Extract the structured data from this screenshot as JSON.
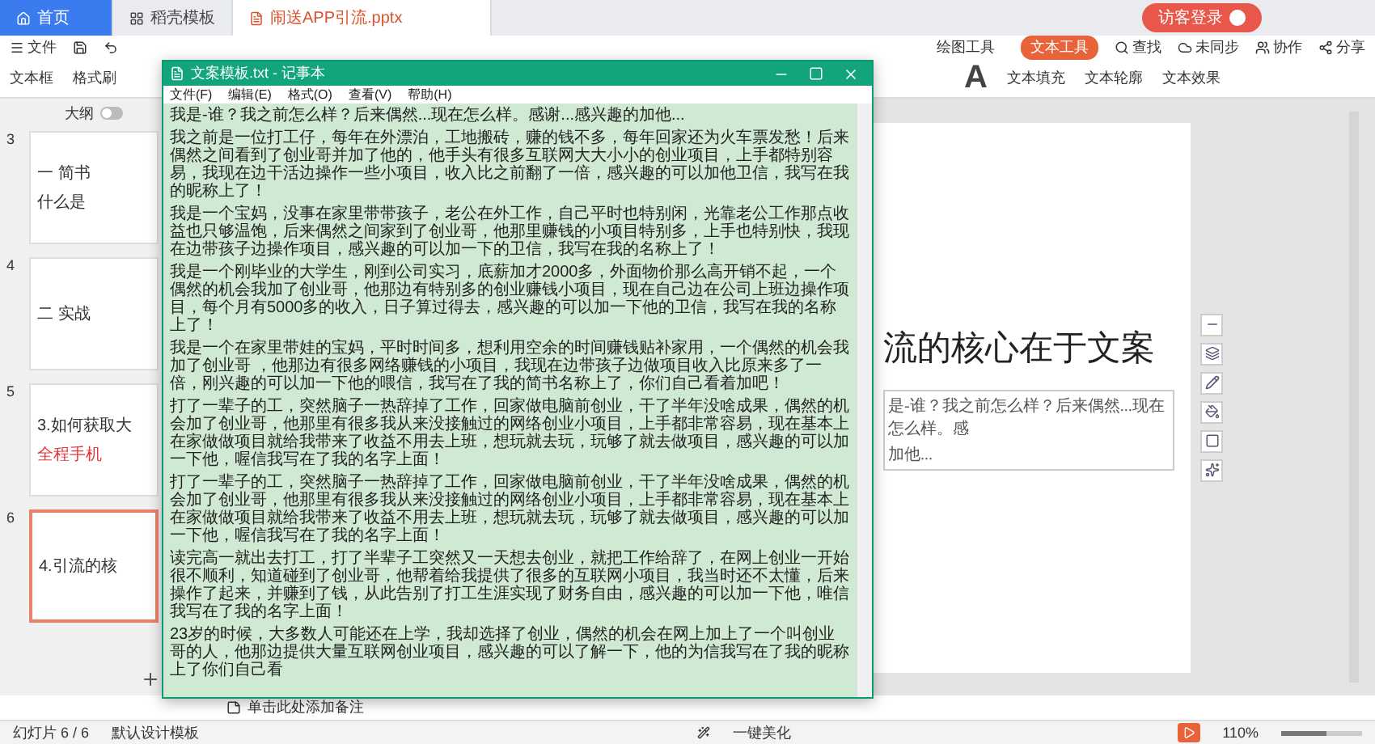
{
  "app_tabs": [
    {
      "label": "首页",
      "kind": "home",
      "selected": false
    },
    {
      "label": "稻壳模板",
      "kind": "store",
      "selected": false
    },
    {
      "label": "闹送APP引流.pptx",
      "kind": "file",
      "selected": true
    }
  ],
  "login_button": "访客登录",
  "menu": {
    "file": "文件",
    "tools": [
      {
        "label": "绘图工具",
        "selected": false
      },
      {
        "label": "文本工具",
        "selected": true
      }
    ],
    "search": "查找",
    "actions": [
      "未同步",
      "协作",
      "分享"
    ]
  },
  "ribbon": {
    "left": [
      "文本框",
      "格式刷"
    ],
    "big_letter": "A",
    "right": [
      "文本填充",
      "文本轮廓",
      "文本效果"
    ]
  },
  "panel": {
    "outline_label": "大纲",
    "view_toggle": {
      "on": false
    },
    "slides": [
      {
        "number": "3",
        "selected": false,
        "lines": [
          {
            "text": "一 简书",
            "kind": "title"
          },
          {
            "text": "什么是",
            "kind": "title"
          }
        ]
      },
      {
        "number": "4",
        "selected": false,
        "lines": [
          {
            "text": "二 实战",
            "kind": "title"
          }
        ]
      },
      {
        "number": "5",
        "selected": false,
        "lines": [
          {
            "text": "3.如何获取大",
            "kind": "title"
          },
          {
            "text": "全程手机",
            "kind": "accent"
          }
        ]
      },
      {
        "number": "6",
        "selected": true,
        "lines": [
          {
            "text": "4.引流的核",
            "kind": "title"
          }
        ]
      }
    ]
  },
  "slide": {
    "title": "流的核心在于文案",
    "body": [
      "是-谁？我之前怎么样？后来偶然...现在怎么样。感",
      "加他..."
    ]
  },
  "notes_placeholder": "单击此处添加备注",
  "notepad": {
    "title": "文案模板.txt - 记事本",
    "menu": [
      "文件(F)",
      "编辑(E)",
      "格式(O)",
      "查看(V)",
      "帮助(H)"
    ],
    "paragraphs": [
      "我是-谁？我之前怎么样？后来偶然...现在怎么样。感谢...感兴趣的加他...",
      "我之前是一位打工仔，每年在外漂泊，工地搬砖，赚的钱不多，每年回家还为火车票发愁！后来偶然之间看到了创业哥并加了他的，他手头有很多互联网大大小小的创业项目，上手都特别容易，我现在边干活边操作一些小项目，收入比之前翻了一倍，感兴趣的可以加他卫信，我写在我的昵称上了！",
      "我是一个宝妈，没事在家里带带孩子，老公在外工作，自己平时也特别闲，光靠老公工作那点收益也只够温饱，后来偶然之间家到了创业哥，他那里赚钱的小项目特别多，上手也特别快，我现在边带孩子边操作项目，感兴趣的可以加一下的卫信，我写在我的名称上了！",
      "我是一个刚毕业的大学生，刚到公司实习，底薪加才2000多，外面物价那么高开销不起，一个偶然的机会我加了创业哥，他那边有特别多的创业赚钱小项目，现在自己边在公司上班边操作项目，每个月有5000多的收入，日子算过得去，感兴趣的可以加一下他的卫信，我写在我的名称上了！",
      "我是一个在家里带娃的宝妈，平时时间多，想利用空余的时间赚钱贴补家用，一个偶然的机会我加了创业哥 ，他那边有很多网络赚钱的小项目，我现在边带孩子边做项目收入比原来多了一倍，刚兴趣的可以加一下他的喂信，我写在了我的简书名称上了，你们自己看着加吧！",
      "打了一辈子的工，突然脑子一热辞掉了工作，回家做电脑前创业，干了半年没啥成果，偶然的机会加了创业哥，他那里有很多我从来没接触过的网络创业小项目，上手都非常容易，现在基本上在家做做项目就给我带来了收益不用去上班，想玩就去玩，玩够了就去做项目，感兴趣的可以加一下他，喔信我写在了我的名字上面！",
      "打了一辈子的工，突然脑子一热辞掉了工作，回家做电脑前创业，干了半年没啥成果，偶然的机会加了创业哥，他那里有很多我从来没接触过的网络创业小项目，上手都非常容易，现在基本上在家做做项目就给我带来了收益不用去上班，想玩就去玩，玩够了就去做项目，感兴趣的可以加一下他，喔信我写在了我的名字上面！",
      "读完高一就出去打工，打了半辈子工突然又一天想去创业，就把工作给辞了，在网上创业一开始很不顺利，知道碰到了创业哥，他帮着给我提供了很多的互联网小项目，我当时还不太懂，后来操作了起来，并赚到了钱，从此告别了打工生涯实现了财务自由，感兴趣的可以加一下他，唯信我写在了我的名字上面！",
      "23岁的时候，大多数人可能还在上学，我却选择了创业，偶然的机会在网上加上了一个叫创业哥的人，他那边提供大量互联网创业项目，感兴趣的可以了解一下，他的为信我写在了我的昵称上了你们自己看"
    ]
  },
  "status_bar": {
    "slide_counter": "幻灯片 6 / 6",
    "template": "默认设计模板",
    "beautify": "一键美化",
    "zoom": "110%",
    "zoom_slider": {
      "level": 0.55
    }
  }
}
